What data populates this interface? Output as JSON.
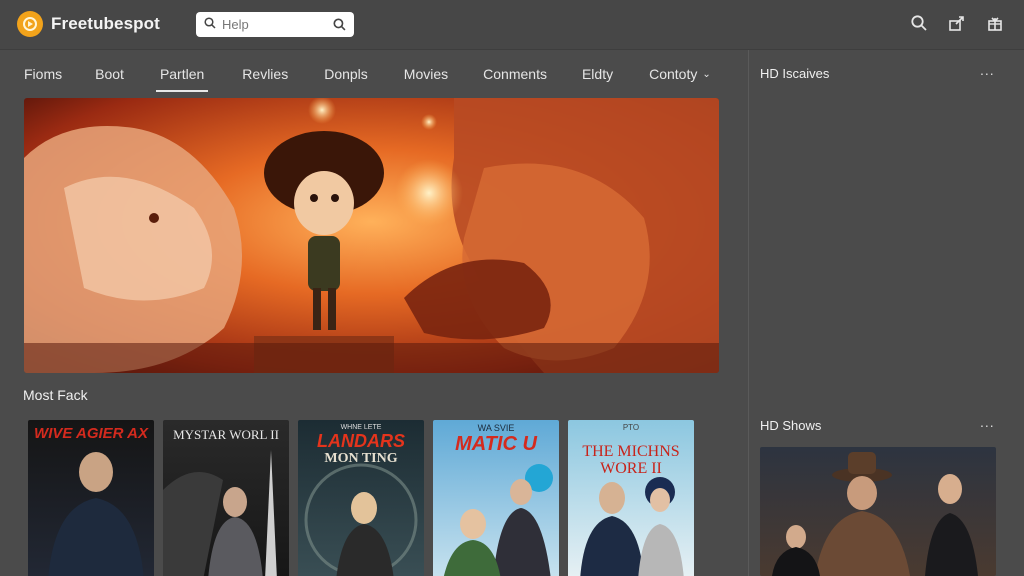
{
  "header": {
    "brand": "Freetubespot",
    "search_placeholder": "Help"
  },
  "nav": {
    "items": [
      {
        "label": "Fioms"
      },
      {
        "label": "Boot"
      },
      {
        "label": "Partlen",
        "active": true
      },
      {
        "label": "Revlies"
      },
      {
        "label": "Donpls"
      },
      {
        "label": "Movies"
      },
      {
        "label": "Conments"
      },
      {
        "label": "Eldty"
      },
      {
        "label": "Contoty"
      }
    ]
  },
  "section": {
    "title": "Most Fack"
  },
  "posters": [
    {
      "title": "WIVE AGIER AX"
    },
    {
      "title": "MYSTAR WORL II"
    },
    {
      "title": "LANDARS",
      "subtitle": "MON TING",
      "tag": "WHNE LETE"
    },
    {
      "title": "MATIC U",
      "tag": "WA SVIE"
    },
    {
      "title": "THE MICHNS WORE II",
      "tag": "PTO"
    }
  ],
  "sidebar": {
    "section1_title": "HD Iscaives",
    "section2_title": "HD Shows",
    "more_label": "..."
  },
  "colors": {
    "background": "#4b4b4b",
    "brand_orange": "#f2a31b",
    "poster_red": "#d42a1e"
  },
  "icons": {
    "logo": "orange-circle-logo",
    "search": "search-icon",
    "top_right": [
      "search-icon",
      "share-icon",
      "gift-icon"
    ]
  }
}
